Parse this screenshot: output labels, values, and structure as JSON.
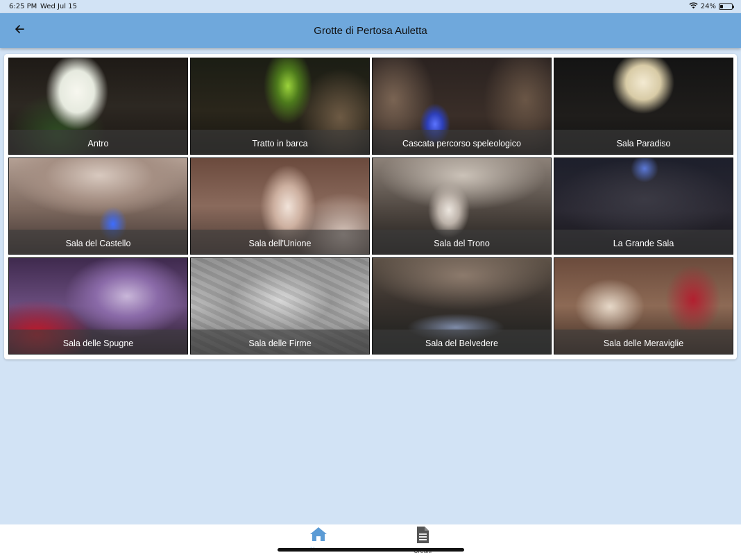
{
  "status_bar": {
    "time": "6:25 PM",
    "date": "Wed Jul 15",
    "battery": "24%",
    "battery_level": 0.24
  },
  "app_bar": {
    "title": "Grotte di Pertosa Auletta",
    "back_icon": "arrow-back-icon"
  },
  "gallery": {
    "items": [
      {
        "label": "Antro"
      },
      {
        "label": "Tratto in barca"
      },
      {
        "label": "Cascata percorso speleologico"
      },
      {
        "label": "Sala Paradiso"
      },
      {
        "label": "Sala del Castello"
      },
      {
        "label": "Sala dell'Unione"
      },
      {
        "label": "Sala del Trono"
      },
      {
        "label": "La Grande Sala"
      },
      {
        "label": "Sala delle Spugne"
      },
      {
        "label": "Sala delle Firme"
      },
      {
        "label": "Sala del Belvedere"
      },
      {
        "label": "Sala delle Meraviglie"
      }
    ]
  },
  "bottom_nav": {
    "items": [
      {
        "label": "Home",
        "icon": "home-icon",
        "active": true
      },
      {
        "label": "Crediti",
        "icon": "document-icon",
        "active": false
      }
    ],
    "active_color": "#5b9bd5"
  },
  "colors": {
    "background": "#d2e3f5",
    "app_bar": "#6fa8dc"
  }
}
